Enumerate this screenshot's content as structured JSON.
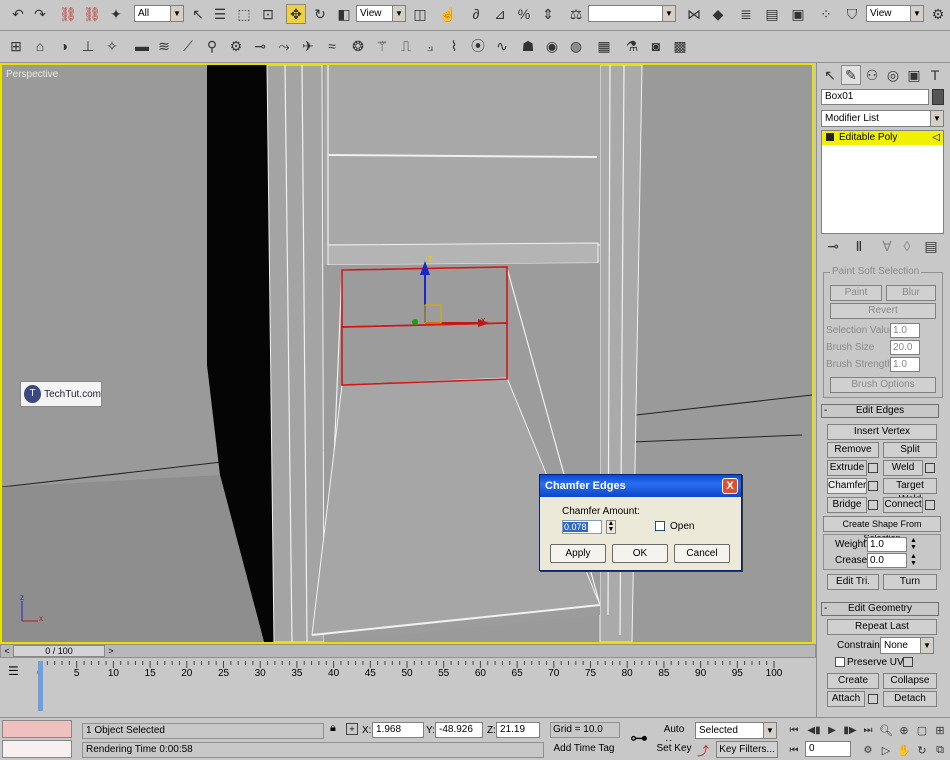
{
  "toolbar": {
    "selection_filter": "All",
    "ref_coord": "View",
    "named_selection": "",
    "ref_coord_2": "View"
  },
  "viewport": {
    "label": "Perspective",
    "watermark": "TechTut.com",
    "gizmo_x": "x",
    "gizmo_z": "z",
    "axis_x": "x",
    "axis_z": "z"
  },
  "dialog": {
    "title": "Chamfer Edges",
    "close_label": "X",
    "amount_label": "Chamfer Amount:",
    "amount_value": "0.078",
    "open_label": "Open",
    "apply_label": "Apply",
    "ok_label": "OK",
    "cancel_label": "Cancel"
  },
  "panel": {
    "object_name": "Box01",
    "modifier_list": "Modifier List",
    "stack_item": "Editable Poly",
    "soft_selection": {
      "title": "Paint Soft Selection",
      "paint": "Paint",
      "blur": "Blur",
      "revert": "Revert",
      "sel_value_label": "Selection Value",
      "sel_value": "1.0",
      "brush_size_label": "Brush Size",
      "brush_size": "20.0",
      "brush_strength_label": "Brush Strength",
      "brush_strength": "1.0",
      "brush_options": "Brush Options"
    },
    "edit_edges": {
      "title": "Edit Edges",
      "insert_vertex": "Insert Vertex",
      "remove": "Remove",
      "split": "Split",
      "extrude": "Extrude",
      "weld": "Weld",
      "chamfer": "Chamfer",
      "target_weld": "Target Weld",
      "bridge": "Bridge",
      "connect": "Connect",
      "create_shape": "Create Shape From Selection",
      "weight_label": "Weight:",
      "weight": "1.0",
      "crease_label": "Crease:",
      "crease": "0.0",
      "edit_tri": "Edit Tri.",
      "turn": "Turn"
    },
    "edit_geometry": {
      "title": "Edit Geometry",
      "repeat_last": "Repeat Last",
      "constraints_label": "Constraints:",
      "constraints_value": "None",
      "preserve_uvs": "Preserve UVs",
      "create": "Create",
      "collapse": "Collapse",
      "attach": "Attach",
      "detach": "Detach"
    }
  },
  "timeline": {
    "frame_counter": "0 / 100",
    "prev_label": "<",
    "next_label": ">",
    "ticks": [
      "0",
      "5",
      "10",
      "15",
      "20",
      "25",
      "30",
      "35",
      "40",
      "45",
      "50",
      "55",
      "60",
      "65",
      "70",
      "75",
      "80",
      "85",
      "90",
      "95",
      "100"
    ]
  },
  "status": {
    "selected_text": "1 Object Selected",
    "render_time": "Rendering Time  0:00:58",
    "x_label": "X:",
    "x_value": "1.968",
    "y_label": "Y:",
    "y_value": "-48.926",
    "z_label": "Z:",
    "z_value": "21.19",
    "grid": "Grid = 10.0",
    "add_time_tag": "Add Time Tag",
    "auto_key": "Auto Key",
    "set_key": "Set Key",
    "key_mode_value": "Selected",
    "key_filters": "Key Filters...",
    "frame_value": "0"
  }
}
